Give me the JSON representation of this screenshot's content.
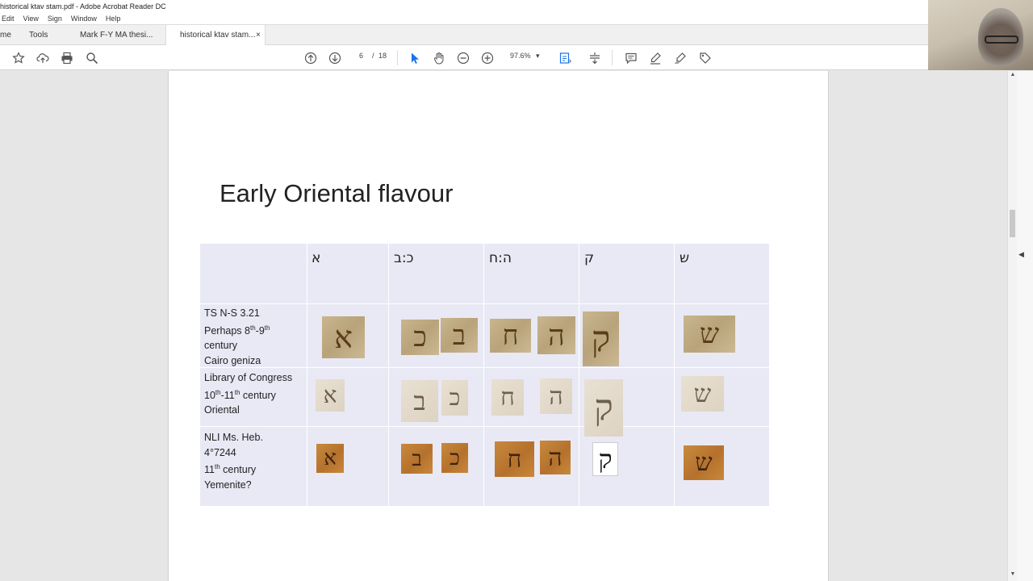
{
  "window": {
    "title": "historical ktav stam.pdf - Adobe Acrobat Reader DC"
  },
  "menu": [
    "Edit",
    "View",
    "Sign",
    "Window",
    "Help"
  ],
  "tabs": {
    "home": "me",
    "tools": "Tools",
    "doc1": "Mark F-Y MA thesi...",
    "doc2": "historical ktav stam...",
    "close": "×"
  },
  "toolbar": {
    "page_current": "6",
    "page_separator": "/",
    "page_total": "18",
    "zoom": "97.6%",
    "zoom_caret": "▾"
  },
  "slide": {
    "title": "Early Oriental flavour",
    "columns": [
      "א",
      "כ:ב",
      "ה:ח",
      "ק",
      "ש"
    ],
    "rows": [
      {
        "line1": "TS N-S 3.21",
        "line2_pre": "Perhaps 8",
        "line2_sup1": "th",
        "line2_mid": "-9",
        "line2_sup2": "th",
        "line3": "century",
        "line4": "Cairo geniza"
      },
      {
        "line1": "Library of Congress",
        "line2_pre": "10",
        "line2_sup1": "th",
        "line2_mid": "-11",
        "line2_sup2": "th",
        "line2_post": " century",
        "line3": "Oriental"
      },
      {
        "line1": "NLI Ms. Heb.",
        "line2": "4°7244",
        "line3_pre": "11",
        "line3_sup": "th",
        "line3_post": " century",
        "line4": "Yemenite?"
      }
    ]
  }
}
